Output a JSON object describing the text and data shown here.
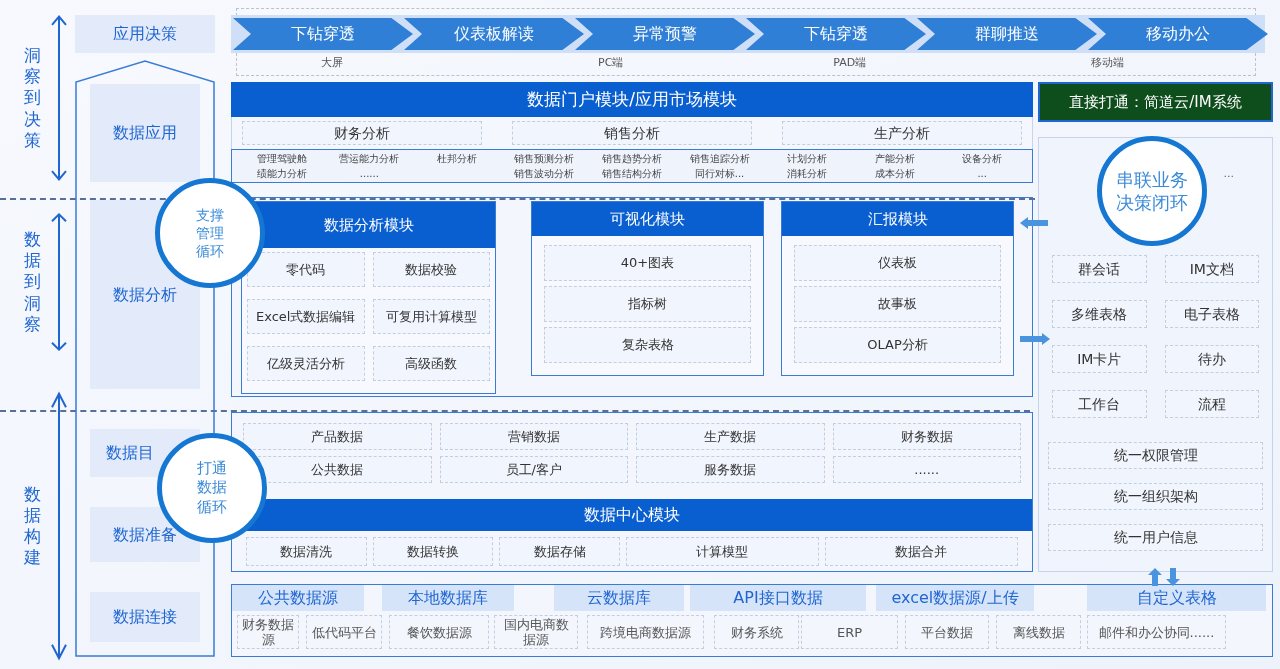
{
  "axis": [
    {
      "label": "洞察到决策"
    },
    {
      "label": "数据到洞察"
    },
    {
      "label": "数据构建"
    }
  ],
  "decision_layer": "应用决策",
  "flow": {
    "steps": [
      "下钻穿透",
      "仪表板解读",
      "异常预警",
      "下钻穿透",
      "群聊推送",
      "移动办公"
    ],
    "devices": [
      "大屏",
      "PC端",
      "PAD端",
      "移动端"
    ]
  },
  "layers": [
    "数据应用",
    "数据分析",
    "数据目",
    "数据准备",
    "数据连接"
  ],
  "portal": {
    "title": "数据门户模块/应用市场模块",
    "groups": [
      {
        "category": "财务分析",
        "items": [
          "管理驾驶舱",
          "营运能力分析",
          "杜邦分析",
          "绩能力分析",
          "......"
        ]
      },
      {
        "category": "销售分析",
        "items": [
          "销售预测分析",
          "销售趋势分析",
          "销售追踪分析",
          "销售波动分析",
          "销售结构分析",
          "同行对标..."
        ]
      },
      {
        "category": "生产分析",
        "items": [
          "计划分析",
          "产能分析",
          "设备分析",
          "消耗分析",
          "成本分析",
          "..."
        ]
      }
    ]
  },
  "modules": [
    {
      "title": "数据分析模块",
      "items": [
        "零代码",
        "数据校验",
        "Excel式数据编辑",
        "可复用计算模型",
        "亿级灵活分析",
        "高级函数"
      ]
    },
    {
      "title": "可视化模块",
      "items": [
        "40+图表",
        "指标树",
        "复杂表格"
      ]
    },
    {
      "title": "汇报模块",
      "items": [
        "仪表板",
        "故事板",
        "OLAP分析"
      ]
    }
  ],
  "data_center": {
    "catalog": [
      "产品数据",
      "营销数据",
      "生产数据",
      "财务数据",
      "公共数据",
      "员工/客户",
      "服务数据",
      "......"
    ],
    "title": "数据中心模块",
    "processes": [
      "数据清洗",
      "数据转换",
      "数据存储",
      "计算模型",
      "数据合并"
    ]
  },
  "sources": {
    "headers": [
      "公共数据源",
      "本地数据库",
      "云数据库",
      "API接口数据",
      "excel数据源/上传",
      "自定义表格"
    ],
    "items": [
      "财务数据源",
      "低代码平台",
      "餐饮数据源",
      "国内电商数据源",
      "跨境电商数据源",
      "财务系统",
      "ERP",
      "平台数据",
      "离线数据",
      "邮件和办公协同......"
    ]
  },
  "integration": {
    "title": "直接打通：简道云/IM系统",
    "loop": "串联业务决策闭环",
    "more": "...",
    "tiles": [
      "群会话",
      "IM文档",
      "多维表格",
      "电子表格",
      "IM卡片",
      "待办",
      "工作台",
      "流程"
    ],
    "services": [
      "统一权限管理",
      "统一组织架构",
      "统一用户信息"
    ]
  },
  "loops": [
    "支撑管理循环",
    "打通数据循环"
  ]
}
